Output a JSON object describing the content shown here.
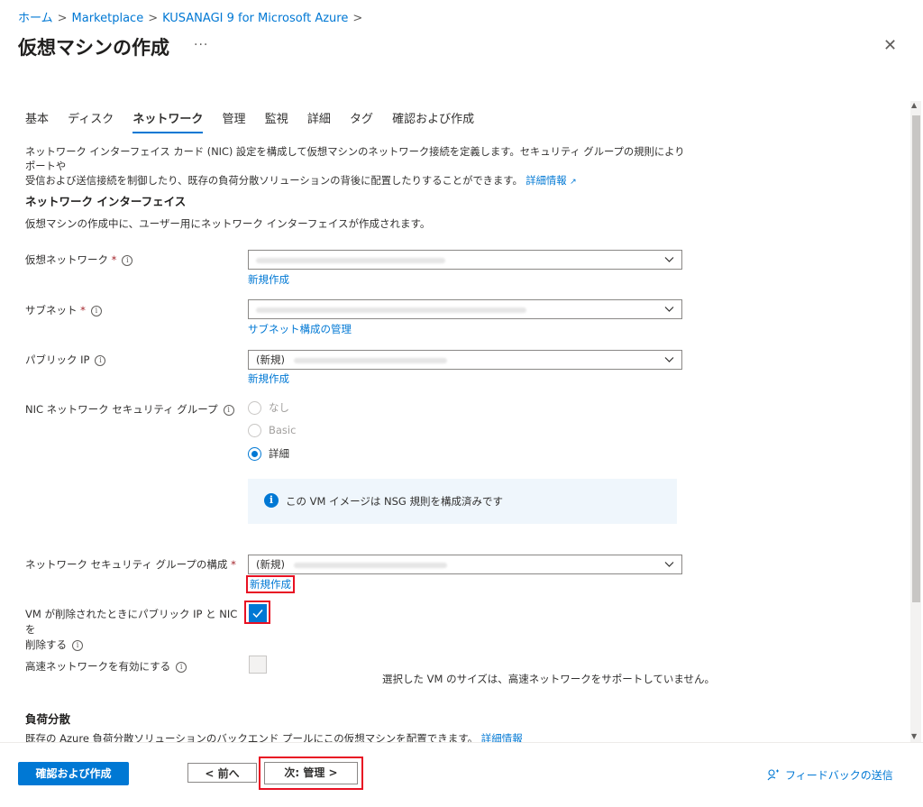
{
  "breadcrumb": [
    {
      "label": "ホーム"
    },
    {
      "label": "Marketplace"
    },
    {
      "label": "KUSANAGI 9 for Microsoft Azure"
    }
  ],
  "page_title": "仮想マシンの作成",
  "more_icon": "···",
  "close_icon": "✕",
  "tabs": [
    {
      "label": "基本"
    },
    {
      "label": "ディスク"
    },
    {
      "label": "ネットワーク",
      "active": true
    },
    {
      "label": "管理"
    },
    {
      "label": "監視"
    },
    {
      "label": "詳細"
    },
    {
      "label": "タグ"
    },
    {
      "label": "確認および作成"
    }
  ],
  "description": {
    "line1": "ネットワーク インターフェイス カード (NIC) 設定を構成して仮想マシンのネットワーク接続を定義します。セキュリティ グループの規則によりポートや",
    "line2": "受信および送信接続を制御したり、既存の負荷分散ソリューションの背後に配置したりすることができます。",
    "link": "詳細情報"
  },
  "network_interface": {
    "heading": "ネットワーク インターフェイス",
    "subtext": "仮想マシンの作成中に、ユーザー用にネットワーク インターフェイスが作成されます。"
  },
  "fields": {
    "vnet": {
      "label": "仮想ネットワーク",
      "required": "*",
      "link": "新規作成"
    },
    "subnet": {
      "label": "サブネット",
      "required": "*",
      "link": "サブネット構成の管理"
    },
    "public_ip": {
      "label": "パブリック IP",
      "value_prefix": "(新規)",
      "link": "新規作成"
    },
    "nic_nsg": {
      "label": "NIC ネットワーク セキュリティ グループ",
      "options": [
        {
          "label": "なし",
          "state": "disabled"
        },
        {
          "label": "Basic",
          "state": "disabled"
        },
        {
          "label": "詳細",
          "state": "selected"
        }
      ],
      "info": "この VM イメージは NSG 規則を構成済みです"
    },
    "nsg_config": {
      "label": "ネットワーク セキュリティ グループの構成",
      "required": "*",
      "value_prefix": "(新規)",
      "link": "新規作成"
    },
    "delete_with_vm": {
      "label_line1": "VM が削除されたときにパブリック IP と NIC を",
      "label_line2": "削除する",
      "checked": true
    },
    "accelerated": {
      "label": "高速ネットワークを有効にする",
      "checked": false,
      "note": "選択した VM のサイズは、高速ネットワークをサポートしていません。"
    }
  },
  "load_balancing": {
    "heading": "負荷分散",
    "subtext": "既存の Azure 負荷分散ソリューションのバックエンド プールにこの仮想マシンを配置できます。",
    "link": "詳細情報"
  },
  "footer": {
    "review_create": "確認および作成",
    "prev": "< 前へ",
    "next": "次: 管理 >",
    "feedback": "フィードバックの送信"
  },
  "colors": {
    "accent": "#0078d4",
    "highlight": "#e81123"
  }
}
